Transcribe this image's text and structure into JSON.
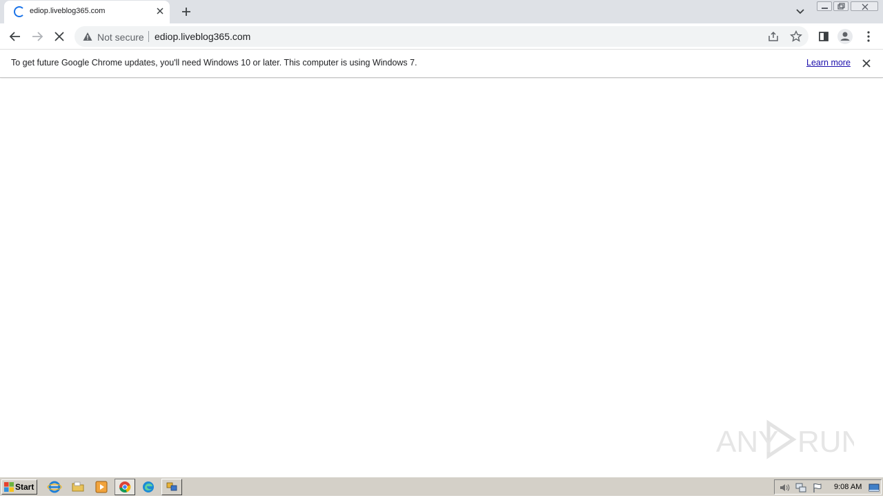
{
  "browser": {
    "tab": {
      "title": "ediop.liveblog365.com",
      "close_icon": "close-icon",
      "loading_icon": "spinner-icon"
    },
    "new_tab_icon": "plus-icon",
    "tab_search_icon": "chevron-down-icon",
    "window_controls": [
      "minimize-icon",
      "restore-icon",
      "close-icon"
    ]
  },
  "toolbar": {
    "back_icon": "arrow-left-icon",
    "forward_icon": "arrow-right-icon",
    "stop_icon": "close-icon",
    "omnibox": {
      "security_label": "Not secure",
      "security_icon": "warning-icon",
      "url": "ediop.liveblog365.com",
      "share_icon": "share-icon",
      "bookmark_icon": "star-icon"
    },
    "side_panel_icon": "side-panel-icon",
    "profile_icon": "person-icon",
    "menu_icon": "more-vertical-icon"
  },
  "infobar": {
    "message": "To get future Google Chrome updates, you'll need Windows 10 or later. This computer is using Windows 7.",
    "learn_more": "Learn more",
    "close_icon": "close-icon"
  },
  "watermark": {
    "text": "ANY RUN"
  },
  "taskbar": {
    "start_label": "Start",
    "apps": [
      "internet-explorer-icon",
      "folder-icon",
      "media-player-icon",
      "chrome-icon",
      "edge-icon",
      "app-window-icon"
    ],
    "tray_icons": [
      "volume-icon",
      "network-icon",
      "flag-icon",
      "show-desktop-icon"
    ],
    "clock": "9:08 AM"
  },
  "colors": {
    "tab_strip": "#dee1e6",
    "omnibox": "#f1f3f4",
    "link": "#1a0dab",
    "spinner": "#1a73e8",
    "taskbar": "#d4d0c8"
  }
}
